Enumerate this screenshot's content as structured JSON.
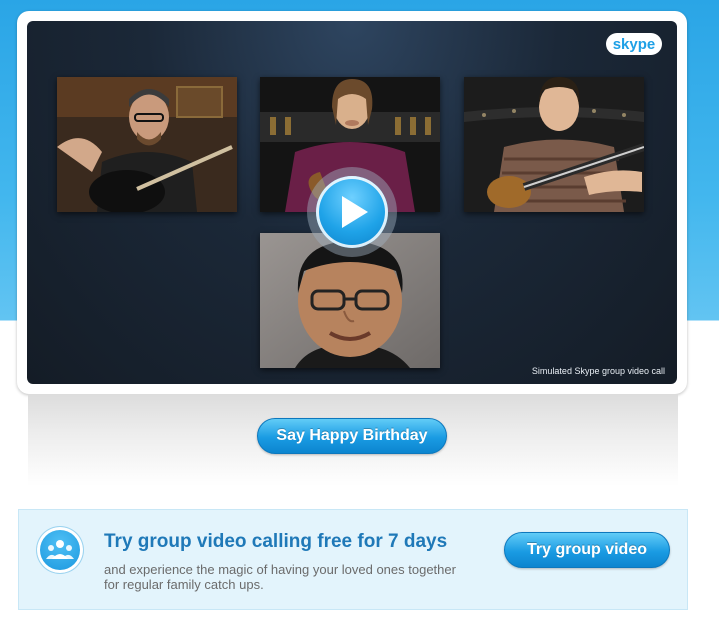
{
  "video": {
    "logo_text": "skype",
    "caption": "Simulated Skype group video call",
    "participants": [
      {
        "name": "participant-1"
      },
      {
        "name": "participant-2"
      },
      {
        "name": "participant-3"
      },
      {
        "name": "participant-4"
      }
    ],
    "play_icon": "play-icon"
  },
  "birthday_button": {
    "label": "Say Happy Birthday"
  },
  "promo": {
    "icon": "group-video-icon",
    "title": "Try group video calling free for 7 days",
    "description": "and experience the magic of having your loved ones together for regular family catch ups.",
    "button_label": "Try group video"
  },
  "colors": {
    "brand_blue": "#1a9be3",
    "title_blue": "#1f79b8",
    "promo_bg": "#e3f4fc",
    "stage_bg": "#1b2838"
  }
}
